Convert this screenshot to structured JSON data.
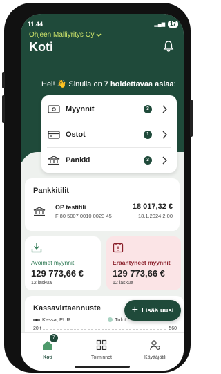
{
  "status": {
    "time": "11.44",
    "battery": "17"
  },
  "header": {
    "company": "Ohjeen Malliyritys Oy",
    "title": "Koti",
    "greeting_prefix": "Hei! 👋 Sinulla on ",
    "greeting_bold": "7 hoidettavaa asiaa",
    "greeting_suffix": ":"
  },
  "tasks": [
    {
      "label": "Myynnit",
      "count": "3",
      "icon": "money-icon"
    },
    {
      "label": "Ostot",
      "count": "1",
      "icon": "card-icon"
    },
    {
      "label": "Pankki",
      "count": "3",
      "icon": "bank-icon"
    }
  ],
  "bank_accounts": {
    "title": "Pankkitilit",
    "name": "OP testitili",
    "iban": "FI80 5007 0010 0023 45",
    "amount": "18 017,32 €",
    "date": "18.1.2024 2:00"
  },
  "open_sales": {
    "label": "Avoimet myynnit",
    "amount": "129 773,66 €",
    "count": "12 laskua"
  },
  "overdue_sales": {
    "label": "Erääntyneet myynnit",
    "amount": "129 773,66 €",
    "count": "12 laskua"
  },
  "cashflow": {
    "title": "Kassavirtaennuste",
    "legend_cash": "Kassa, EUR",
    "legend_income": "Tulot",
    "tick_left": "20 t",
    "tick_right": "560"
  },
  "fab": {
    "label": "Lisää uusi"
  },
  "nav": {
    "items": [
      {
        "label": "Koti",
        "badge": "7"
      },
      {
        "label": "Toiminnot"
      },
      {
        "label": "Käyttäjätili"
      }
    ]
  },
  "colors": {
    "brand": "#1f4a3a",
    "accent": "#cde36a",
    "overdue_bg": "#fbe4e6",
    "sales_label": "#2f7a55",
    "overdue_label": "#8a1f2a"
  }
}
